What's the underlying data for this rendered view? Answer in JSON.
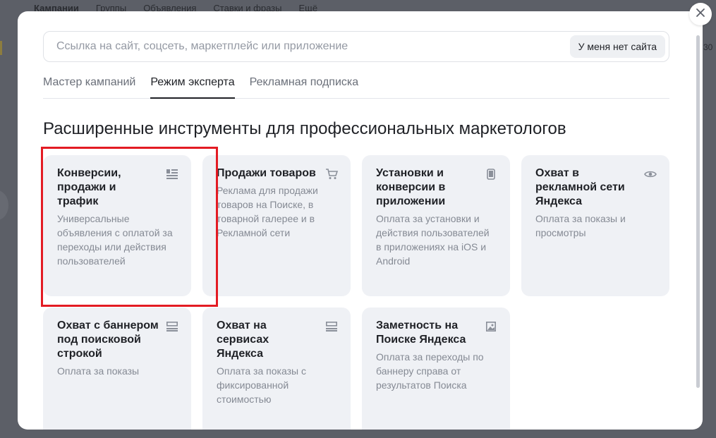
{
  "background": {
    "nav": [
      "Кампании",
      "Группы",
      "Объявления",
      "Ставки и фразы",
      "Ещё"
    ],
    "right_text": "30"
  },
  "modal": {
    "url_placeholder": "Ссылка на сайт, соцсеть, маркетплейс или приложение",
    "url_value": "",
    "no_site_label": "У меня нет сайта",
    "tabs": [
      {
        "label": "Мастер кампаний",
        "active": false
      },
      {
        "label": "Режим эксперта",
        "active": true
      },
      {
        "label": "Рекламная подписка",
        "active": false
      }
    ],
    "section_title": "Расширенные инструменты для профессиональных маркетологов",
    "cards": [
      {
        "title": "Конверсии, продажи и трафик",
        "desc": "Универсальные объявления с оплатой за переходы или действия пользователей",
        "icon": "list-icon"
      },
      {
        "title": "Продажи товаров",
        "desc": "Реклама для продажи товаров на Поиске, в товарной галерее и в Рекламной сети",
        "icon": "cart-icon"
      },
      {
        "title": "Установки и конверсии в приложении",
        "desc": "Оплата за установки и действия пользователей в приложениях на iOS и Android",
        "icon": "phone-icon"
      },
      {
        "title": "Охват в рекламной сети Яндекса",
        "desc": "Оплата за показы и просмотры",
        "icon": "eye-icon"
      },
      {
        "title": "Охват с баннером под поисковой строкой",
        "desc": "Оплата за показы",
        "icon": "banner-icon"
      },
      {
        "title": "Охват на сервисах Яндекса",
        "desc": "Оплата за показы с фиксированной стоимостью",
        "icon": "banner-icon"
      },
      {
        "title": "Заметность на Поиске Яндекса",
        "desc": "Оплата за переходы по баннеру справа от результатов Поиска",
        "icon": "image-icon"
      }
    ]
  },
  "colors": {
    "highlight": "#e31b23",
    "card_bg": "#eff1f5"
  }
}
